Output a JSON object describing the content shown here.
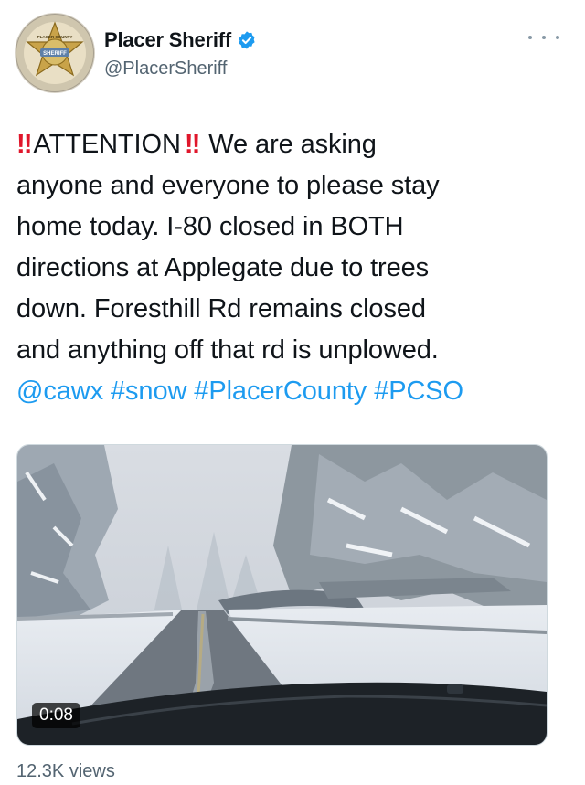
{
  "author": {
    "display_name": "Placer Sheriff",
    "handle": "@PlacerSheriff",
    "verified": true,
    "avatar_icon": "sheriff-star-badge-icon",
    "badge_text_top": "PLACER COUNTY",
    "badge_text_center": "SHERIFF"
  },
  "tweet": {
    "bang_1": "‼",
    "attention": "ATTENTION",
    "bang_2": "‼",
    "line_1_rest": " We are asking",
    "line_2": "anyone and everyone to please stay",
    "line_3": "home today. I-80 closed in BOTH",
    "line_4": "directions at Applegate due to trees",
    "line_5": "down. Foresthill Rd remains closed",
    "line_6": "and anything off that rd is unplowed.",
    "mention": "@cawx",
    "hashtags": [
      "#snow",
      "#PlacerCounty",
      "#PCSO"
    ]
  },
  "media": {
    "type": "video",
    "duration": "0:08",
    "scene_icon": "snowy-road-video-thumbnail"
  },
  "stats": {
    "views": "12.3K views"
  },
  "colors": {
    "link": "#1d9bf0",
    "secondary_text": "#536471",
    "emoji_red": "#e0162b"
  }
}
